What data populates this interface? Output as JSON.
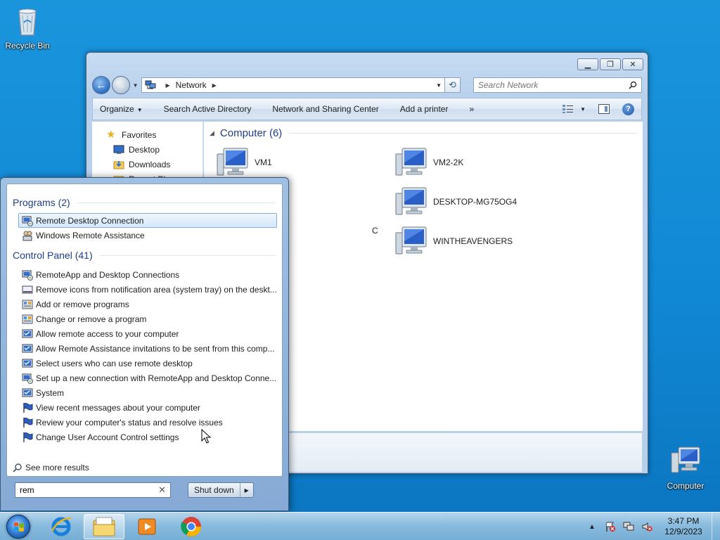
{
  "desktop": {
    "recycle_bin": "Recycle Bin",
    "computer": "Computer"
  },
  "explorer": {
    "address": {
      "crumb": "Network"
    },
    "search_placeholder": "Search Network",
    "toolbar": {
      "organize": "Organize",
      "search_ad": "Search Active Directory",
      "network_sharing": "Network and Sharing Center",
      "add_printer": "Add a printer",
      "more": "»"
    },
    "nav": {
      "favorites": "Favorites",
      "desktop": "Desktop",
      "downloads": "Downloads",
      "recent": "Recent Places"
    },
    "group_title": "Computer (6)",
    "computers": [
      {
        "name": "VM1"
      },
      {
        "name": "VM2-2K"
      },
      {
        "name": "DESKTOP-MG75OG4"
      },
      {
        "name": "C"
      },
      {
        "name": "WINTHEAVENGERS"
      }
    ]
  },
  "start_menu": {
    "programs_header": "Programs (2)",
    "programs": [
      {
        "label": "Remote Desktop Connection",
        "icon": "remote-desktop-icon",
        "selected": true
      },
      {
        "label": "Windows Remote Assistance",
        "icon": "remote-assistance-icon"
      }
    ],
    "control_panel_header": "Control Panel (41)",
    "control_panel": [
      {
        "label": "RemoteApp and Desktop Connections",
        "icon": "remoteapp-icon"
      },
      {
        "label": "Remove icons from notification area (system tray) on the deskt...",
        "icon": "notification-area-icon"
      },
      {
        "label": "Add or remove programs",
        "icon": "programs-icon"
      },
      {
        "label": "Change or remove a program",
        "icon": "programs-icon"
      },
      {
        "label": "Allow remote access to your computer",
        "icon": "system-icon"
      },
      {
        "label": "Allow Remote Assistance invitations to be sent from this comp...",
        "icon": "system-icon"
      },
      {
        "label": "Select users who can use remote desktop",
        "icon": "system-icon"
      },
      {
        "label": "Set up a new connection with RemoteApp and Desktop Conne...",
        "icon": "remoteapp-icon"
      },
      {
        "label": "System",
        "icon": "system-icon"
      },
      {
        "label": "View recent messages about your computer",
        "icon": "action-center-flag-icon"
      },
      {
        "label": "Review your computer's status and resolve issues",
        "icon": "action-center-flag-icon"
      },
      {
        "label": "Change User Account Control settings",
        "icon": "action-center-flag-icon"
      }
    ],
    "see_more": "See more results",
    "search_value": "rem",
    "shutdown": "Shut down"
  },
  "taskbar": {
    "time": "3:47 PM",
    "date": "12/9/2023"
  }
}
